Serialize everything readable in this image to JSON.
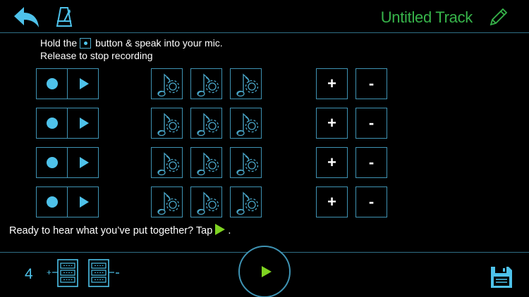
{
  "header": {
    "track_title": "Untitled Track",
    "back_icon": "back-arrow-icon",
    "metronome_icon": "metronome-icon",
    "edit_icon": "pencil-icon"
  },
  "instructions": {
    "line1_before": "Hold the",
    "line1_after": "button & speak into your mic.",
    "line2": "Release to stop recording"
  },
  "rows": [
    {
      "plus_label": "+",
      "minus_label": "-"
    },
    {
      "plus_label": "+",
      "minus_label": "-"
    },
    {
      "plus_label": "+",
      "minus_label": "-"
    },
    {
      "plus_label": "+",
      "minus_label": "-"
    }
  ],
  "prompt": {
    "text": "Ready to hear what you’ve put together? Tap",
    "suffix": "."
  },
  "footer": {
    "track_count": "4",
    "save_icon": "save-disk-icon"
  },
  "colors": {
    "accent": "#4ec2ea",
    "border": "#3f93b3",
    "title_green": "#37b44a",
    "play_green": "#7ed321"
  }
}
